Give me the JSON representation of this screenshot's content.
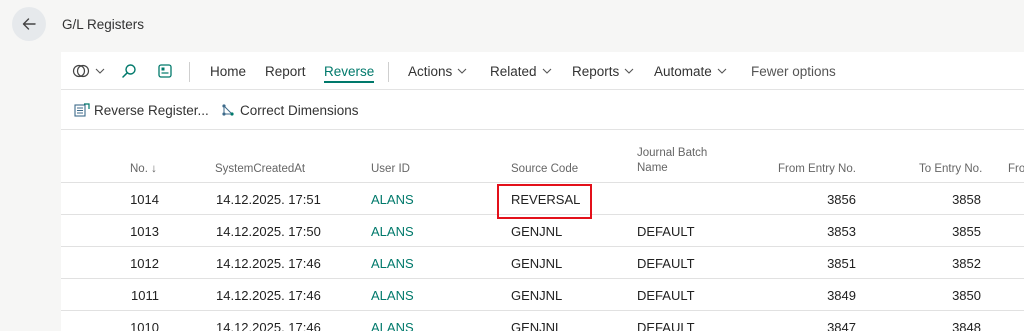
{
  "header": {
    "title": "G/L Registers"
  },
  "actionbar": {
    "home": "Home",
    "report": "Report",
    "reverse": "Reverse",
    "actions": "Actions",
    "related": "Related",
    "reports": "Reports",
    "automate": "Automate",
    "fewer_options": "Fewer options"
  },
  "subbar": {
    "reverse_register": "Reverse Register...",
    "correct_dimensions": "Correct Dimensions"
  },
  "table": {
    "columns": {
      "no": "No. ↓",
      "created": "SystemCreatedAt",
      "user": "User ID",
      "source": "Source Code",
      "batch_line1": "Journal Batch",
      "batch_line2": "Name",
      "from": "From Entry No.",
      "to": "To Entry No.",
      "fro": "Fro"
    },
    "rows": [
      {
        "no": "1014",
        "created": "14.12.2025. 17:51",
        "user": "ALANS",
        "source": "REVERSAL",
        "batch": "",
        "from": "3856",
        "to": "3858"
      },
      {
        "no": "1013",
        "created": "14.12.2025. 17:50",
        "user": "ALANS",
        "source": "GENJNL",
        "batch": "DEFAULT",
        "from": "3853",
        "to": "3855"
      },
      {
        "no": "1012",
        "created": "14.12.2025. 17:46",
        "user": "ALANS",
        "source": "GENJNL",
        "batch": "DEFAULT",
        "from": "3851",
        "to": "3852"
      },
      {
        "no": "1011",
        "created": "14.12.2025. 17:46",
        "user": "ALANS",
        "source": "GENJNL",
        "batch": "DEFAULT",
        "from": "3849",
        "to": "3850"
      },
      {
        "no": "1010",
        "created": "14.12.2025. 17:46",
        "user": "ALANS",
        "source": "GENJNL",
        "batch": "DEFAULT",
        "from": "3847",
        "to": "3848"
      }
    ]
  },
  "colors": {
    "accent": "#00796b",
    "highlight": "#e3101a"
  }
}
